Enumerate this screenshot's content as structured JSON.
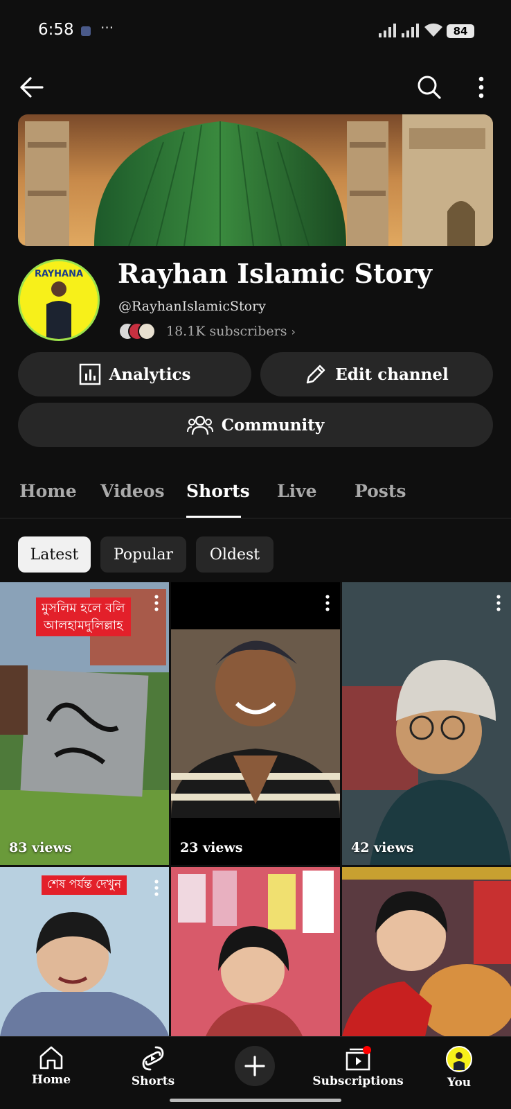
{
  "status_bar": {
    "time": "6:58",
    "dots": "···",
    "battery": "84"
  },
  "channel": {
    "title": "Rayhan Islamic Story",
    "handle": "@RayhanIslamicStory",
    "subscribers": "18.1K subscribers",
    "avatar_text": "RAYHANA"
  },
  "actions": {
    "analytics": "Analytics",
    "edit_channel": "Edit channel",
    "community": "Community"
  },
  "tabs": [
    "Home",
    "Videos",
    "Shorts",
    "Live",
    "Posts"
  ],
  "active_tab": "Shorts",
  "filters": [
    "Latest",
    "Popular",
    "Oldest"
  ],
  "active_filter": "Latest",
  "shorts": [
    {
      "views": "83 views",
      "caption_line1": "মুসলিম হলে বলি",
      "caption_line2": "আলহামদুলিল্লাহ"
    },
    {
      "views": "23 views"
    },
    {
      "views": "42 views"
    },
    {
      "views": "",
      "caption_line1": "শেষ পর্যন্ত দেখুন"
    },
    {
      "views": ""
    },
    {
      "views": ""
    }
  ],
  "bottom_nav": {
    "home": "Home",
    "shorts": "Shorts",
    "subscriptions": "Subscriptions",
    "you": "You"
  },
  "colors": {
    "background": "#0f0f0f",
    "button": "#272727",
    "accent_red": "#ff0000"
  }
}
